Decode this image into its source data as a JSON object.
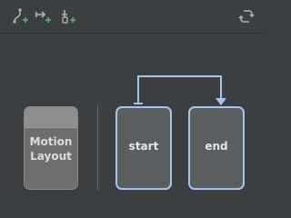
{
  "toolbar": {
    "create_constraint_set_icon": "create-constraint-set-icon",
    "create_transition_icon": "create-transition-icon",
    "create_click_handler_icon": "create-click-handler-icon",
    "cycle_icon": "cycle-icon"
  },
  "overview": {
    "motion_layout_label_line1": "Motion",
    "motion_layout_label_line2": "Layout",
    "states": [
      {
        "label": "start"
      },
      {
        "label": "end"
      }
    ]
  },
  "colors": {
    "background": "#3c3f41",
    "selection_blue": "#a3c6ee",
    "icon_green": "#59a869",
    "icon_gray": "#afb1b3"
  }
}
